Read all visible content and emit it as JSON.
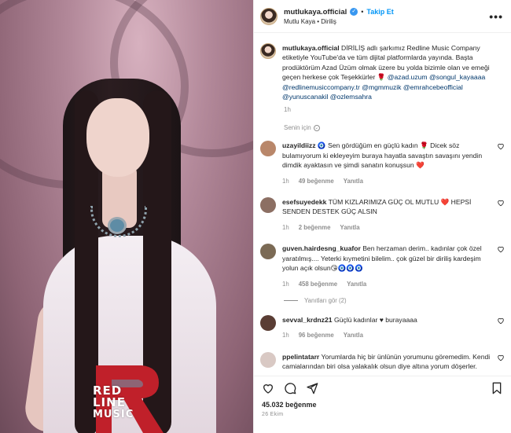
{
  "header": {
    "username": "mutlukaya.official",
    "follow_label": "Takip Et",
    "subtitle": "Mutlu Kaya • Diriliş",
    "more_label": "•••"
  },
  "logo": {
    "line1": "RED",
    "line2": "LINE",
    "line3": "MUSIC"
  },
  "caption": {
    "username": "mutlukaya.official",
    "text": "DİRİLİŞ adlı şarkımız Redline Music Company etiketiyle YouTube'da ve tüm dijital platformlarda yayında. Başta prodüktörüm Azad Üzüm olmak üzere bu yolda bizimle olan ve emeği geçen herkese çok Teşekkürler 🌹",
    "mentions": "@azad.uzum @songul_kayaaaa @redlinemusiccompany.tr @mgmmuzik @emrahcebeofficial @yunuscanakil @ozlemsahra",
    "time": "1h"
  },
  "translate_label": "Senin için",
  "comments": [
    {
      "username": "uzayildiizz",
      "text": "🧿 Sen gördüğüm en güçlü kadın 🌹 Dicek söz bulamıyorum ki ekleyeyim buraya hayatla savaştın savaşını yendin dimdik ayaktasın ve şimdi sanatın konuşsun ❤️",
      "time": "1h",
      "likes": "49 beğenme",
      "reply": "Yanıtla",
      "avatar_color": "#b9876a"
    },
    {
      "username": "esefsuyedekk",
      "text": "TÜM KIZLARIMIZA GÜÇ OL MUTLU ❤️ HEPSİ SENDEN DESTEK GÜÇ ALSIN",
      "time": "1h",
      "likes": "2 beğenme",
      "reply": "Yanıtla",
      "avatar_color": "#8c6f63"
    },
    {
      "username": "guven.hairdesng_kuafor",
      "text": "Ben herzaman derim.. kadınlar çok özel yaratılmış.... Yeterki kıymetini bilelim.. çok güzel bir diriliş kardeşim yolun açık olsun😘🧿🧿🧿",
      "time": "1h",
      "likes": "458 beğenme",
      "reply": "Yanıtla",
      "avatar_color": "#7b6a55"
    },
    {
      "username": "sevval_krdnz21",
      "text": "Güçlü kadınlar ♥ burayaaaa",
      "time": "1h",
      "likes": "96 beğenme",
      "reply": "Yanıtla",
      "avatar_color": "#5a3d34"
    },
    {
      "username": "ppelintatarr",
      "text": "Yorumlarda hiç bir ünlünün yorumunu göremedim. Kendi camialarından biri olsa yalakalık olsun diye altına yorum döşerler.",
      "avatar_color": "#d9c9c4"
    }
  ],
  "view_replies": "Yanıtları gör (2)",
  "likes_total": "45.032 beğenme",
  "date": "26 Ekim",
  "colors": {
    "link": "#0095f6",
    "mention": "#00376b",
    "muted": "#8e8e8e",
    "text": "#262626"
  },
  "icons": [
    "heart-icon",
    "comment-icon",
    "share-icon",
    "bookmark-icon",
    "more-icon",
    "verified-icon"
  ]
}
